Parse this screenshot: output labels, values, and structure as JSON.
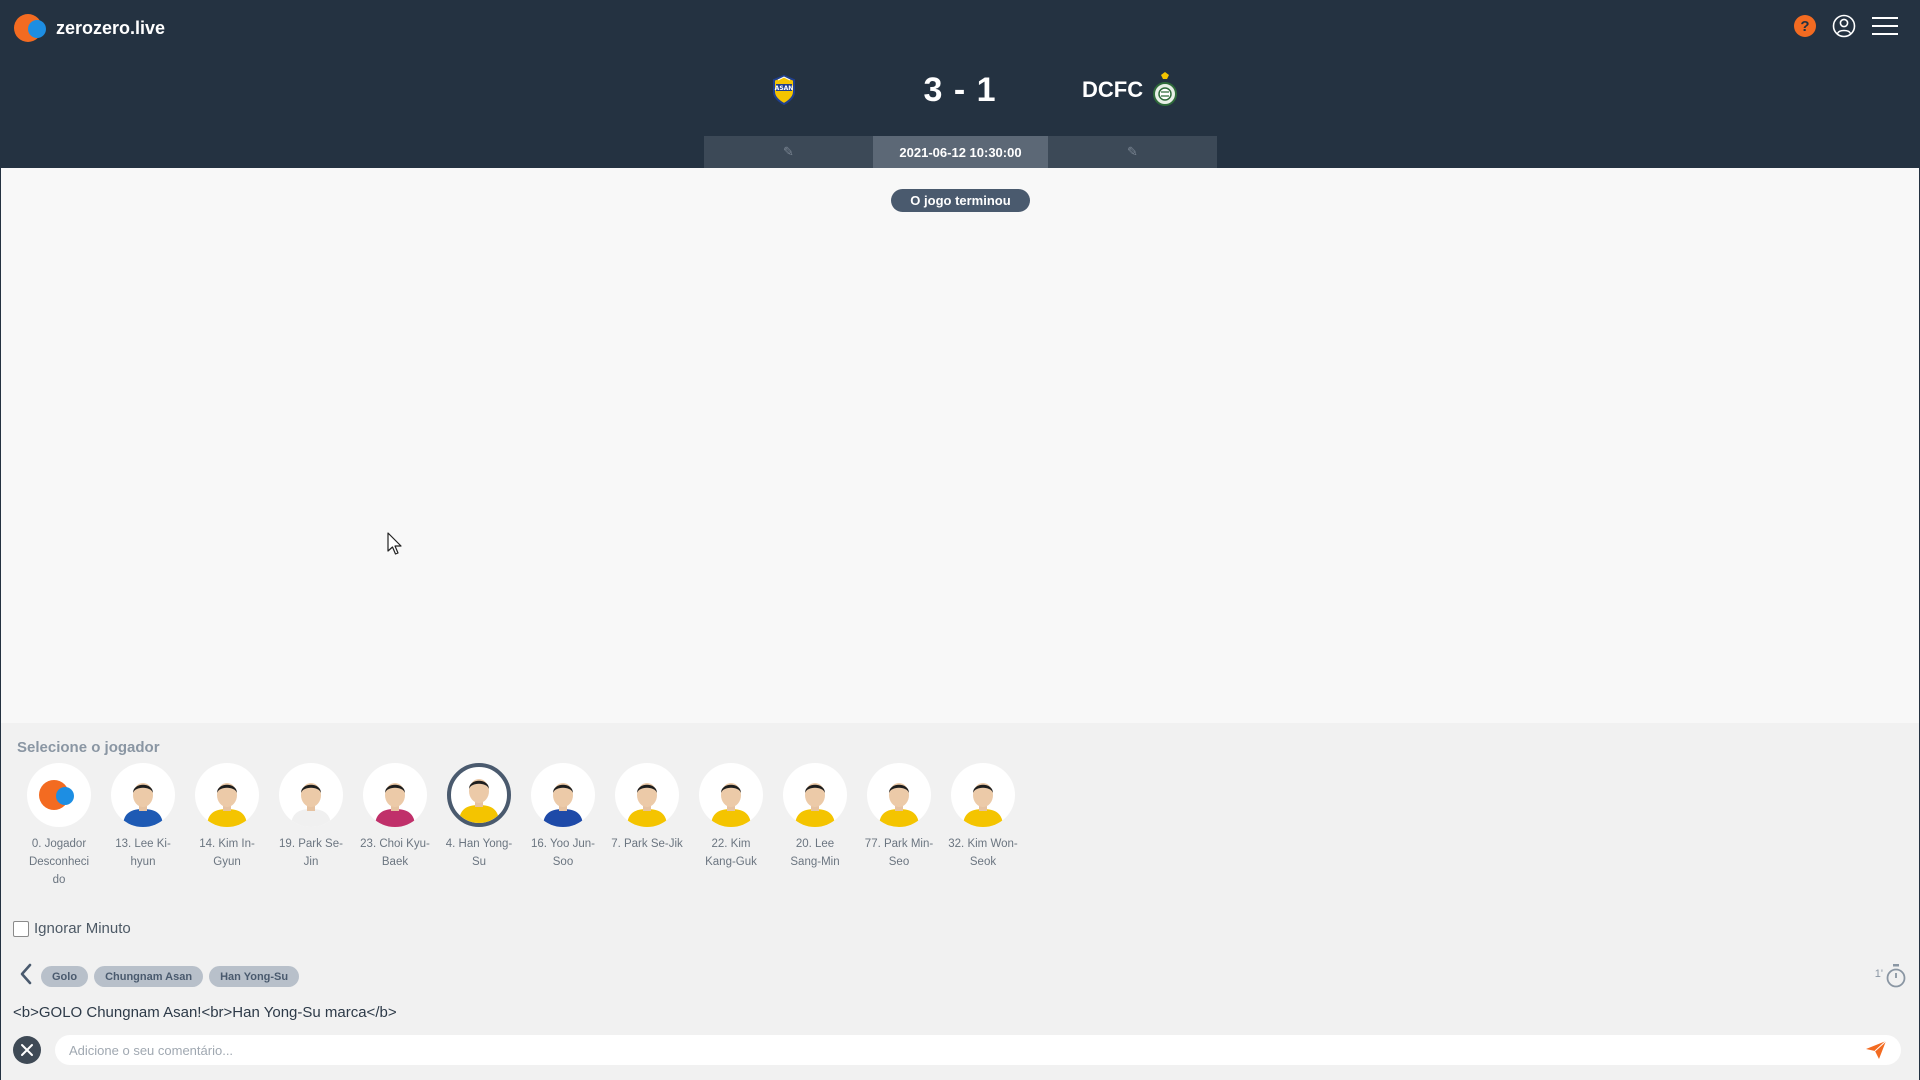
{
  "brand": {
    "name": "zerozero.live"
  },
  "header": {
    "help_icon_glyph": "?",
    "away_team": "DCFC",
    "score": "3 - 1",
    "datetime": "2021-06-12 10:30:00",
    "left_tab_icon": "pencil-icon",
    "right_tab_icon": "pencil-icon"
  },
  "main": {
    "status": "O jogo terminou"
  },
  "panel": {
    "select_title": "Selecione o jogador",
    "players": [
      {
        "name": "0. Jogador Desconheci do",
        "kind": "unknown"
      },
      {
        "name": "13. Lee Ki-hyun",
        "kit": "#1e5ab4"
      },
      {
        "name": "14. Kim In-Gyun",
        "kit": "#f4c400"
      },
      {
        "name": "19. Park Se-Jin",
        "kit": "#f0f0f0"
      },
      {
        "name": "23. Choi Kyu-Baek",
        "kit": "#c0306a"
      },
      {
        "name": "4. Han Yong-Su",
        "kit": "#f4c400",
        "selected": true
      },
      {
        "name": "16. Yoo Jun-Soo",
        "kit": "#1e4aa8"
      },
      {
        "name": "7. Park Se-Jik",
        "kit": "#f4c400"
      },
      {
        "name": "22. Kim Kang-Guk",
        "kit": "#f4c400"
      },
      {
        "name": "20. Lee Sang-Min",
        "kit": "#f4c400"
      },
      {
        "name": "77. Park Min-Seo",
        "kit": "#f4c400"
      },
      {
        "name": "32. Kim Won-Seok",
        "kit": "#f4c400"
      }
    ],
    "ignore_minute_label": "Ignorar Minuto",
    "tags": [
      "Golo",
      "Chungnam Asan",
      "Han Yong-Su"
    ],
    "timer_minute": "1'",
    "comment_text": "<b>GOLO Chungnam Asan!<br>Han Yong-Su marca</b>",
    "comment_placeholder": "Adicione o seu comentário..."
  },
  "colors": {
    "header_bg": "#243241",
    "accent_orange": "#f36b21",
    "accent_blue": "#1d8ee3",
    "badge": "#4a5a6e"
  }
}
